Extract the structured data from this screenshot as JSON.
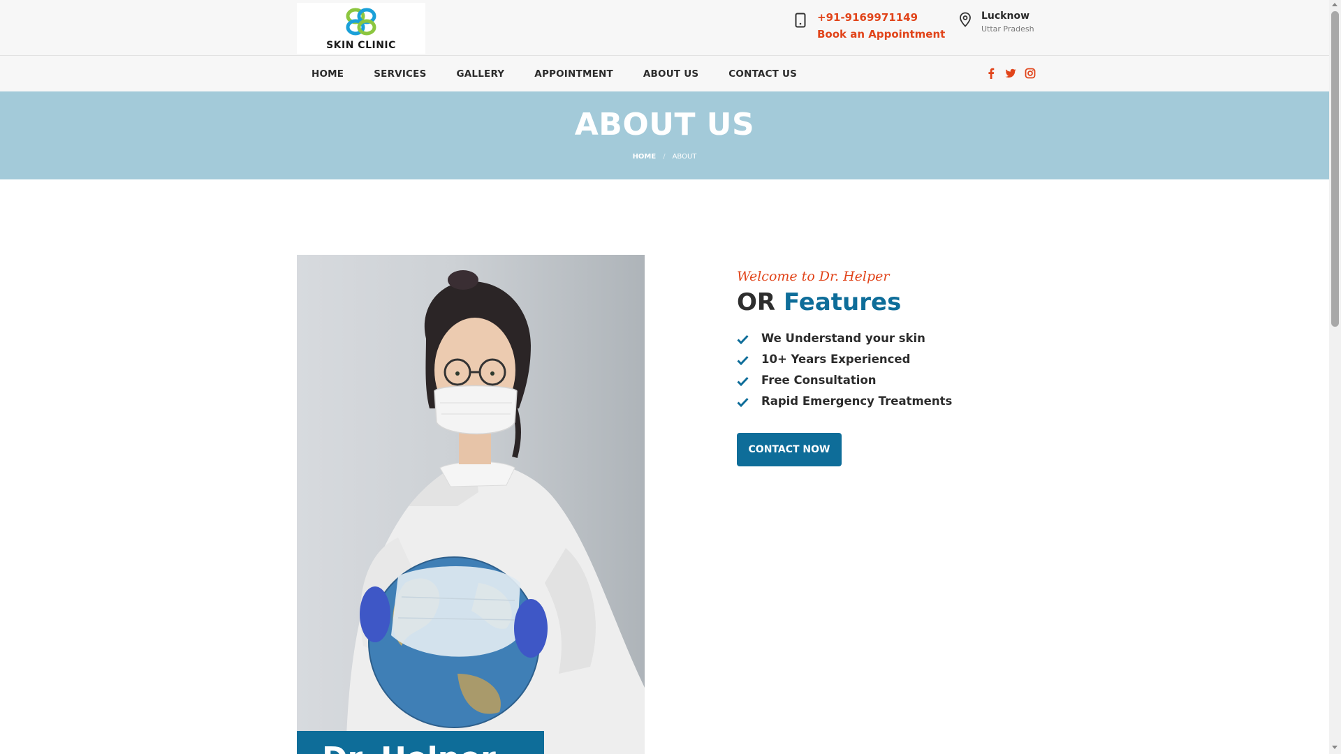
{
  "logo": {
    "text": "SKIN CLINIC"
  },
  "header": {
    "phone": "+91-9169971149",
    "book_label": "Book an Appointment",
    "city": "Lucknow",
    "state": "Uttar Pradesh"
  },
  "nav": {
    "items": [
      "HOME",
      "SERVICES",
      "GALLERY",
      "APPOINTMENT",
      "ABOUT US",
      "CONTACT US"
    ]
  },
  "social": {
    "icons": [
      "facebook-icon",
      "twitter-icon",
      "instagram-icon"
    ],
    "color": "#e1441a"
  },
  "page_header": {
    "title": "ABOUT US",
    "breadcrumb_home": "HOME",
    "breadcrumb_sep": "/",
    "breadcrumb_current": "ABOUT"
  },
  "doctor": {
    "name": "Dr. Helper"
  },
  "about": {
    "welcome": "Welcome to Dr. Helper",
    "title_prefix": "OR",
    "title_accent": "Features",
    "features": [
      "We Understand your skin",
      "10+ Years Experienced",
      "Free Consultation",
      "Rapid Emergency Treatments"
    ],
    "button_label": "CONTACT NOW"
  },
  "colors": {
    "accent_orange": "#e1441a",
    "brand_blue": "#0e6d99",
    "header_band": "#a3cad9"
  }
}
